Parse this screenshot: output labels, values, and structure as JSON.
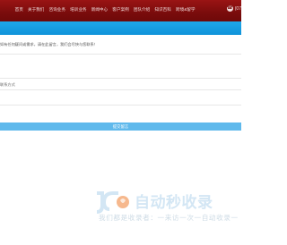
{
  "header": {
    "nav_items": [
      "首页",
      "关于我们",
      "咨询业务",
      "培训业务",
      "新闻中心",
      "客户案例",
      "团队介绍",
      "知识百科",
      "跨境&留学"
    ],
    "phone_text": "(07",
    "accent_color": "#7a0c0c",
    "bar_color": "#1093d9"
  },
  "form": {
    "notice": "如有任何疑问或需求，请在此留言，我们会尽快与您联系！",
    "contact_label": "联系方式",
    "submit_label": "提交留言",
    "button_color": "#5fb9ec"
  },
  "watermark": {
    "title": "自动秒收录",
    "subtitle": "我们都是收录者：一来访一次一自动收录一"
  }
}
